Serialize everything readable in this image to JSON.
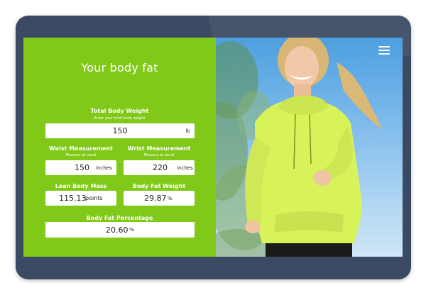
{
  "app": {
    "title": "Your body fat"
  },
  "total_weight": {
    "label": "Total Body Weight",
    "hint": "Enter your total body weight",
    "value": "150",
    "unit": "lb"
  },
  "waist": {
    "label": "Waist Measurement",
    "hint": "Measure at naval",
    "value": "150",
    "unit": "inches"
  },
  "wrist": {
    "label": "Wrist Measurement",
    "hint": "Measure at naval",
    "value": "220",
    "unit": "inches"
  },
  "lean_mass": {
    "label": "Lean Body Mass",
    "value": "115.13",
    "unit": "points"
  },
  "fat_weight": {
    "label": "Body Fat Weight",
    "value": "29.87",
    "unit": "%"
  },
  "fat_percentage": {
    "label": "Body Fat Percentage",
    "value": "20.60",
    "unit": "%"
  },
  "header": {
    "menu_icon": "hamburger-menu-icon"
  },
  "colors": {
    "panel_green": "#80c919",
    "tablet_frame": "#3b4a63",
    "hoodie": "#d8f25a"
  }
}
